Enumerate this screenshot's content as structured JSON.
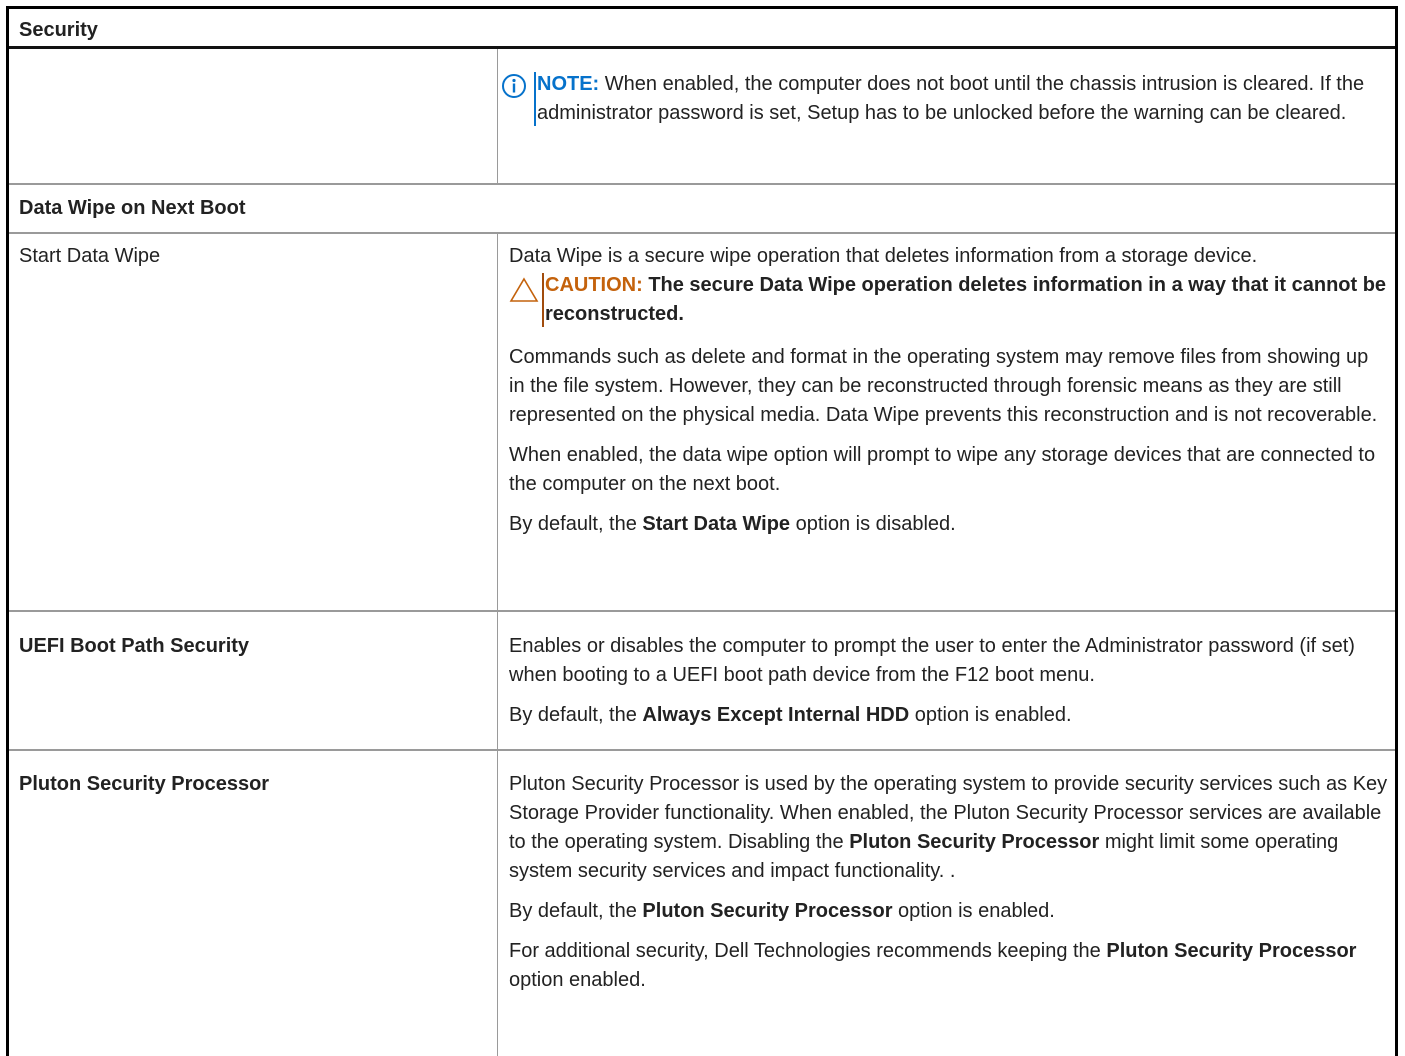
{
  "header": {
    "title": "Security"
  },
  "note": {
    "label": "NOTE:",
    "text": " When enabled, the computer does not boot until the chassis intrusion is cleared. If the administrator password is set, Setup has to be unlocked before the warning can be cleared."
  },
  "section_data_wipe": {
    "title": "Data Wipe on Next Boot"
  },
  "start_data_wipe": {
    "label": "Start Data Wipe",
    "desc": "Data Wipe is a secure wipe operation that deletes information from a storage device.",
    "caution_label": "CAUTION:",
    "caution_text": " The secure Data Wipe operation deletes information in a way that it cannot be reconstructed.",
    "para2": "Commands such as delete and format in the operating system may remove files from showing up in the file system. However, they can be reconstructed through forensic means as they are still represented on the physical media. Data Wipe prevents this reconstruction and is not recoverable.",
    "para3": "When enabled, the data wipe option will prompt to wipe any storage devices that are connected to the computer on the next boot.",
    "default_pre": "By default, the ",
    "default_bold": "Start Data Wipe",
    "default_post": " option is disabled."
  },
  "uefi_boot": {
    "label": "UEFI Boot Path Security",
    "desc": "Enables or disables the computer to prompt the user to enter the Administrator password (if set) when booting to a UEFI boot path device from the F12 boot menu.",
    "default_pre": "By default, the ",
    "default_bold": "Always Except Internal HDD",
    "default_post": " option is enabled."
  },
  "pluton": {
    "label": "Pluton Security Processor",
    "desc_pre": "Pluton Security Processor is used by the operating system to provide security services such as Key Storage Provider functionality. When enabled, the Pluton Security Processor services are available to the operating system. Disabling the ",
    "desc_bold": "Pluton Security Processor",
    "desc_post": " might limit some operating system security services and impact functionality. .",
    "default_pre": "By default, the ",
    "default_bold": "Pluton Security Processor",
    "default_post": " option is enabled.",
    "rec_pre": "For additional security, Dell Technologies recommends keeping the ",
    "rec_bold": "Pluton Security Processor",
    "rec_post": " option enabled."
  }
}
